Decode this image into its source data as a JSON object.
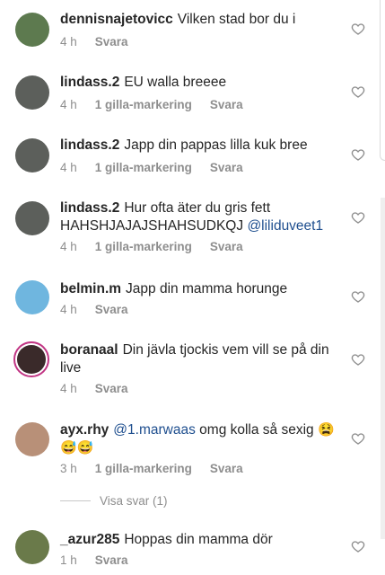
{
  "comments": [
    {
      "user": "dennisnajetovicc",
      "text": "Vilken stad bor du i",
      "time": "4 h",
      "likes": "",
      "reply": "Svara"
    },
    {
      "user": "lindass.2",
      "text": "EU walla breeee",
      "time": "4 h",
      "likes": "1 gilla-markering",
      "reply": "Svara"
    },
    {
      "user": "lindass.2",
      "text": "Japp din pappas lilla kuk bree",
      "time": "4 h",
      "likes": "1 gilla-markering",
      "reply": "Svara"
    },
    {
      "user": "lindass.2",
      "text": "Hur ofta äter du gris fett HAHSHJAJAJSHAHSUDKQJ",
      "mention": "@liliduveet1",
      "time": "4 h",
      "likes": "1 gilla-markering",
      "reply": "Svara"
    },
    {
      "user": "belmin.m",
      "text": "Japp din mamma horunge",
      "time": "4 h",
      "likes": "",
      "reply": "Svara"
    },
    {
      "user": "boranaal",
      "text": "Din jävla tjockis vem vill se på din live",
      "time": "4 h",
      "likes": "",
      "reply": "Svara"
    },
    {
      "user": "ayx.rhy",
      "mention": "@1.marwaas",
      "text": "omg kolla så sexig",
      "emoji": "😫 😅😅",
      "time": "3 h",
      "likes": "1 gilla-markering",
      "reply": "Svara"
    },
    {
      "user": "_azur285",
      "text": "Hoppas din mamma dör",
      "time": "1 h",
      "likes": "",
      "reply": "Svara"
    }
  ],
  "view_replies": "Visa svar (1)",
  "icons": {
    "like": "heart-outline-icon"
  },
  "colors": {
    "text": "#262626",
    "meta": "#8e8e8e",
    "mention": "#1f4f8f"
  }
}
